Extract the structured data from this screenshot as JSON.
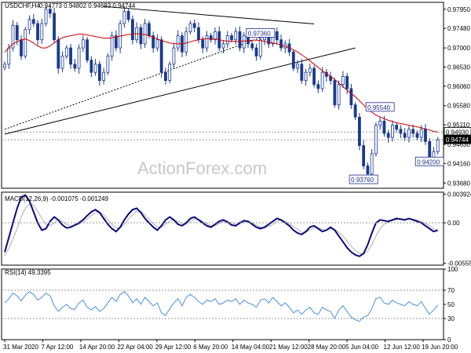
{
  "header": {
    "symbol_text": "USDCHF,H4",
    "ohlc_text": "0.94773 0.94802 0.94683 0.94744"
  },
  "watermark": "ActionForex.com",
  "colors": {
    "background": "#ffffff",
    "candle": "#1a3a8c",
    "ma": "#cc0000",
    "trendline": "#000000",
    "label_border": "#1f2a8a",
    "macd_line": "#0a0a7a",
    "macd_signal": "#b0b0b0",
    "rsi_line": "#4a90e2",
    "dotted_level": "#9a9a9a",
    "grid_axis": "#000000"
  },
  "chart_data": [
    {
      "type": "candlestick",
      "panel": "price",
      "title": "USDCHF,H4 0.94773 0.94802 0.94683 0.94744",
      "x_tick_labels": [
        "31 Mar 2020",
        "7 Apr 12:00",
        "14 Apr 20:00",
        "22 Apr 04:00",
        "29 Apr 12:00",
        "6 May 20:00",
        "14 May 04:00",
        "21 May 12:00",
        "28 May 20:00",
        "5 Jun 04:00",
        "12 Jun 12:00",
        "19 Jun 20:00"
      ],
      "y_tick_labels": [
        "0.97950",
        "0.97480",
        "0.97000",
        "0.96530",
        "0.96060",
        "0.95580",
        "0.95110",
        "0.94630",
        "0.94160",
        "0.93680"
      ],
      "ylim": [
        0.9355,
        0.9812
      ],
      "price_labels": [
        {
          "text": "0.97360",
          "x_index": 62,
          "value": 0.9736
        },
        {
          "text": "0.95540",
          "x_index": 91,
          "value": 0.9554
        },
        {
          "text": "0.94200",
          "x_index": 103,
          "value": 0.942
        },
        {
          "text": "0.93760",
          "x_index": 87,
          "value": 0.9376
        }
      ],
      "right_axis_labels": [
        {
          "text": "0.94930",
          "value": 0.9493
        },
        {
          "text": "0.94744",
          "value": 0.94744
        }
      ],
      "candles_close": [
        0.966,
        0.97,
        0.9755,
        0.972,
        0.968,
        0.9745,
        0.977,
        0.976,
        0.972,
        0.976,
        0.9795,
        0.9785,
        0.972,
        0.965,
        0.968,
        0.97,
        0.966,
        0.965,
        0.97,
        0.972,
        0.967,
        0.964,
        0.966,
        0.962,
        0.964,
        0.968,
        0.973,
        0.97,
        0.976,
        0.979,
        0.977,
        0.972,
        0.975,
        0.971,
        0.976,
        0.973,
        0.97,
        0.972,
        0.964,
        0.962,
        0.966,
        0.97,
        0.973,
        0.969,
        0.974,
        0.976,
        0.975,
        0.972,
        0.97,
        0.973,
        0.972,
        0.974,
        0.97,
        0.971,
        0.973,
        0.972,
        0.974,
        0.97,
        0.973,
        0.971,
        0.97,
        0.968,
        0.972,
        0.973,
        0.971,
        0.974,
        0.972,
        0.97,
        0.971,
        0.969,
        0.965,
        0.966,
        0.962,
        0.964,
        0.965,
        0.961,
        0.96,
        0.964,
        0.963,
        0.962,
        0.956,
        0.961,
        0.963,
        0.96,
        0.956,
        0.953,
        0.946,
        0.941,
        0.939,
        0.944,
        0.951,
        0.952,
        0.949,
        0.948,
        0.951,
        0.95,
        0.949,
        0.948,
        0.95,
        0.949,
        0.948,
        0.95,
        0.947,
        0.943,
        0.9445,
        0.9474
      ],
      "series": [
        {
          "name": "MA",
          "type": "line",
          "values_note_hidden": false
        }
      ],
      "ma_values": [
        0.969,
        0.97,
        0.971,
        0.9715,
        0.972,
        0.9722,
        0.9718,
        0.9712,
        0.9705,
        0.97,
        0.97,
        0.9705,
        0.9712,
        0.972,
        0.9725,
        0.9728,
        0.973,
        0.9732,
        0.9734,
        0.9734,
        0.9732,
        0.973,
        0.9728,
        0.9726,
        0.9724,
        0.9724,
        0.9725,
        0.9727,
        0.9729,
        0.9731,
        0.9733,
        0.9734,
        0.9735,
        0.9734,
        0.9733,
        0.973,
        0.9726,
        0.9722,
        0.9718,
        0.9715,
        0.9712,
        0.9711,
        0.971,
        0.971,
        0.9712,
        0.9715,
        0.9718,
        0.972,
        0.9722,
        0.9723,
        0.9723,
        0.9722,
        0.972,
        0.9718,
        0.9717,
        0.9716,
        0.9716,
        0.9716,
        0.9717,
        0.9718,
        0.9719,
        0.9719,
        0.9718,
        0.9716,
        0.9714,
        0.9712,
        0.971,
        0.9707,
        0.9704,
        0.97,
        0.9695,
        0.969,
        0.9683,
        0.9676,
        0.9668,
        0.966,
        0.9652,
        0.9644,
        0.9637,
        0.963,
        0.9622,
        0.9614,
        0.9605,
        0.9596,
        0.9588,
        0.958,
        0.957,
        0.956,
        0.955,
        0.9542,
        0.9535,
        0.953,
        0.9526,
        0.9522,
        0.9519,
        0.9516,
        0.9514,
        0.9512,
        0.951,
        0.9508,
        0.9506,
        0.9504,
        0.9501,
        0.9498,
        0.9495,
        0.9493
      ],
      "trendlines": [
        {
          "x_index_start": 0,
          "value_start": 0.9488,
          "x_index_end": 85,
          "value_end": 0.97,
          "style": "solid"
        },
        {
          "x_index_start": 24,
          "value_start": 0.9802,
          "x_index_end": 75,
          "value_end": 0.9759,
          "style": "solid"
        },
        {
          "x_index_start": 0,
          "value_start": 0.95,
          "x_index_end": 65,
          "value_end": 0.9736,
          "style": "dotted"
        }
      ],
      "dotted_levels": [
        0.9493,
        0.94744
      ]
    },
    {
      "type": "line",
      "panel": "macd",
      "title": "MACD(12,26,9) -0.001075 -0.001249",
      "y_tick_labels": [
        "0.003924",
        "0.00",
        "-0.005555"
      ],
      "ylim": [
        -0.0058,
        0.0042
      ],
      "series": [
        {
          "name": "MACD",
          "values": [
            -0.004,
            -0.002,
            0.0,
            0.002,
            0.0035,
            0.0038,
            0.003,
            0.0015,
            0.0,
            -0.001,
            -0.0008,
            0.0002,
            0.0008,
            0.0004,
            -0.0003,
            -0.0007,
            -0.0006,
            -0.0003,
            0.0,
            0.0004,
            0.001,
            0.0015,
            0.0018,
            0.0014,
            0.0006,
            -0.0002,
            -0.0008,
            -0.0012,
            -0.0006,
            0.0004,
            0.0012,
            0.0018,
            0.002,
            0.0014,
            0.0006,
            0.0,
            -0.0006,
            -0.001,
            -0.0004,
            0.0004,
            0.0008,
            0.0004,
            -0.0002,
            -0.0004,
            0.0,
            0.0006,
            0.0008,
            0.0004,
            0.0,
            -0.0004,
            -0.0006,
            -0.0002,
            0.0002,
            0.0004,
            0.0001,
            -0.0003,
            -0.0004,
            0.0,
            0.0003,
            0.0002,
            -0.0002,
            -0.0006,
            -0.0008,
            -0.0006,
            -0.0002,
            0.0002,
            0.0006,
            0.0004,
            0.0,
            -0.0004,
            -0.001,
            -0.0014,
            -0.0016,
            -0.0012,
            -0.0006,
            -0.0004,
            -0.0008,
            -0.0012,
            -0.001,
            -0.0006,
            -0.001,
            -0.0018,
            -0.0026,
            -0.0034,
            -0.004,
            -0.0044,
            -0.0046,
            -0.0042,
            -0.003,
            -0.0014,
            0.0,
            0.0004,
            0.0003,
            0.0002,
            0.0004,
            0.0006,
            0.0005,
            0.0004,
            0.0006,
            0.0004,
            0.0002,
            0.0,
            -0.0004,
            -0.0008,
            -0.0012,
            -0.001
          ]
        },
        {
          "name": "Signal",
          "values": [
            -0.0045,
            -0.0035,
            -0.0022,
            -0.0008,
            0.0008,
            0.002,
            0.0026,
            0.0024,
            0.0016,
            0.0006,
            -0.0002,
            -0.0004,
            0.0,
            0.0004,
            0.0002,
            -0.0002,
            -0.0004,
            -0.0004,
            -0.0002,
            0.0001,
            0.0005,
            0.001,
            0.0014,
            0.0015,
            0.0011,
            0.0004,
            -0.0002,
            -0.0007,
            -0.0007,
            -0.0002,
            0.0005,
            0.0011,
            0.0016,
            0.0016,
            0.0011,
            0.0005,
            -0.0001,
            -0.0006,
            -0.0006,
            -0.0002,
            0.0003,
            0.0004,
            0.0002,
            -0.0001,
            -0.0002,
            0.0002,
            0.0005,
            0.0005,
            0.0002,
            -0.0001,
            -0.0004,
            -0.0004,
            -0.0001,
            0.0002,
            0.0002,
            0.0,
            -0.0002,
            -0.0002,
            0.0001,
            0.0002,
            0.0,
            -0.0003,
            -0.0006,
            -0.0007,
            -0.0005,
            -0.0002,
            0.0002,
            0.0004,
            0.0002,
            -0.0001,
            -0.0005,
            -0.0009,
            -0.0013,
            -0.0013,
            -0.001,
            -0.0007,
            -0.0007,
            -0.0009,
            -0.001,
            -0.0008,
            -0.0009,
            -0.0013,
            -0.0018,
            -0.0025,
            -0.0032,
            -0.0038,
            -0.0042,
            -0.0043,
            -0.0039,
            -0.003,
            -0.0018,
            -0.0008,
            -0.0002,
            0.0001,
            0.0003,
            0.0004,
            0.0005,
            0.0005,
            0.0005,
            0.0005,
            0.0004,
            0.0002,
            -0.0001,
            -0.0004,
            -0.0008,
            -0.0011
          ]
        }
      ]
    },
    {
      "type": "line",
      "panel": "rsi",
      "title": "RSI(14) 49.3395",
      "y_tick_labels": [
        "100",
        "70",
        "50",
        "30",
        "0"
      ],
      "ylim": [
        0,
        100
      ],
      "levels": [
        70,
        30
      ],
      "series": [
        {
          "name": "RSI",
          "values": [
            52,
            58,
            66,
            62,
            55,
            63,
            68,
            64,
            56,
            60,
            66,
            62,
            48,
            40,
            46,
            50,
            44,
            43,
            52,
            56,
            46,
            42,
            47,
            40,
            44,
            52,
            60,
            54,
            64,
            68,
            62,
            52,
            58,
            50,
            60,
            54,
            48,
            52,
            38,
            34,
            44,
            52,
            58,
            48,
            60,
            64,
            60,
            54,
            50,
            56,
            54,
            58,
            50,
            52,
            56,
            54,
            58,
            50,
            56,
            52,
            50,
            46,
            56,
            58,
            52,
            60,
            54,
            48,
            52,
            46,
            38,
            42,
            36,
            42,
            46,
            38,
            36,
            46,
            42,
            40,
            30,
            42,
            48,
            40,
            32,
            28,
            26,
            32,
            34,
            44,
            58,
            60,
            52,
            50,
            56,
            52,
            50,
            48,
            54,
            50,
            48,
            54,
            44,
            36,
            42,
            49
          ]
        }
      ]
    }
  ],
  "macd_header": "MACD(12,26,9) -0.001075 -0.001249",
  "rsi_header": "RSI(14) 49.3395"
}
